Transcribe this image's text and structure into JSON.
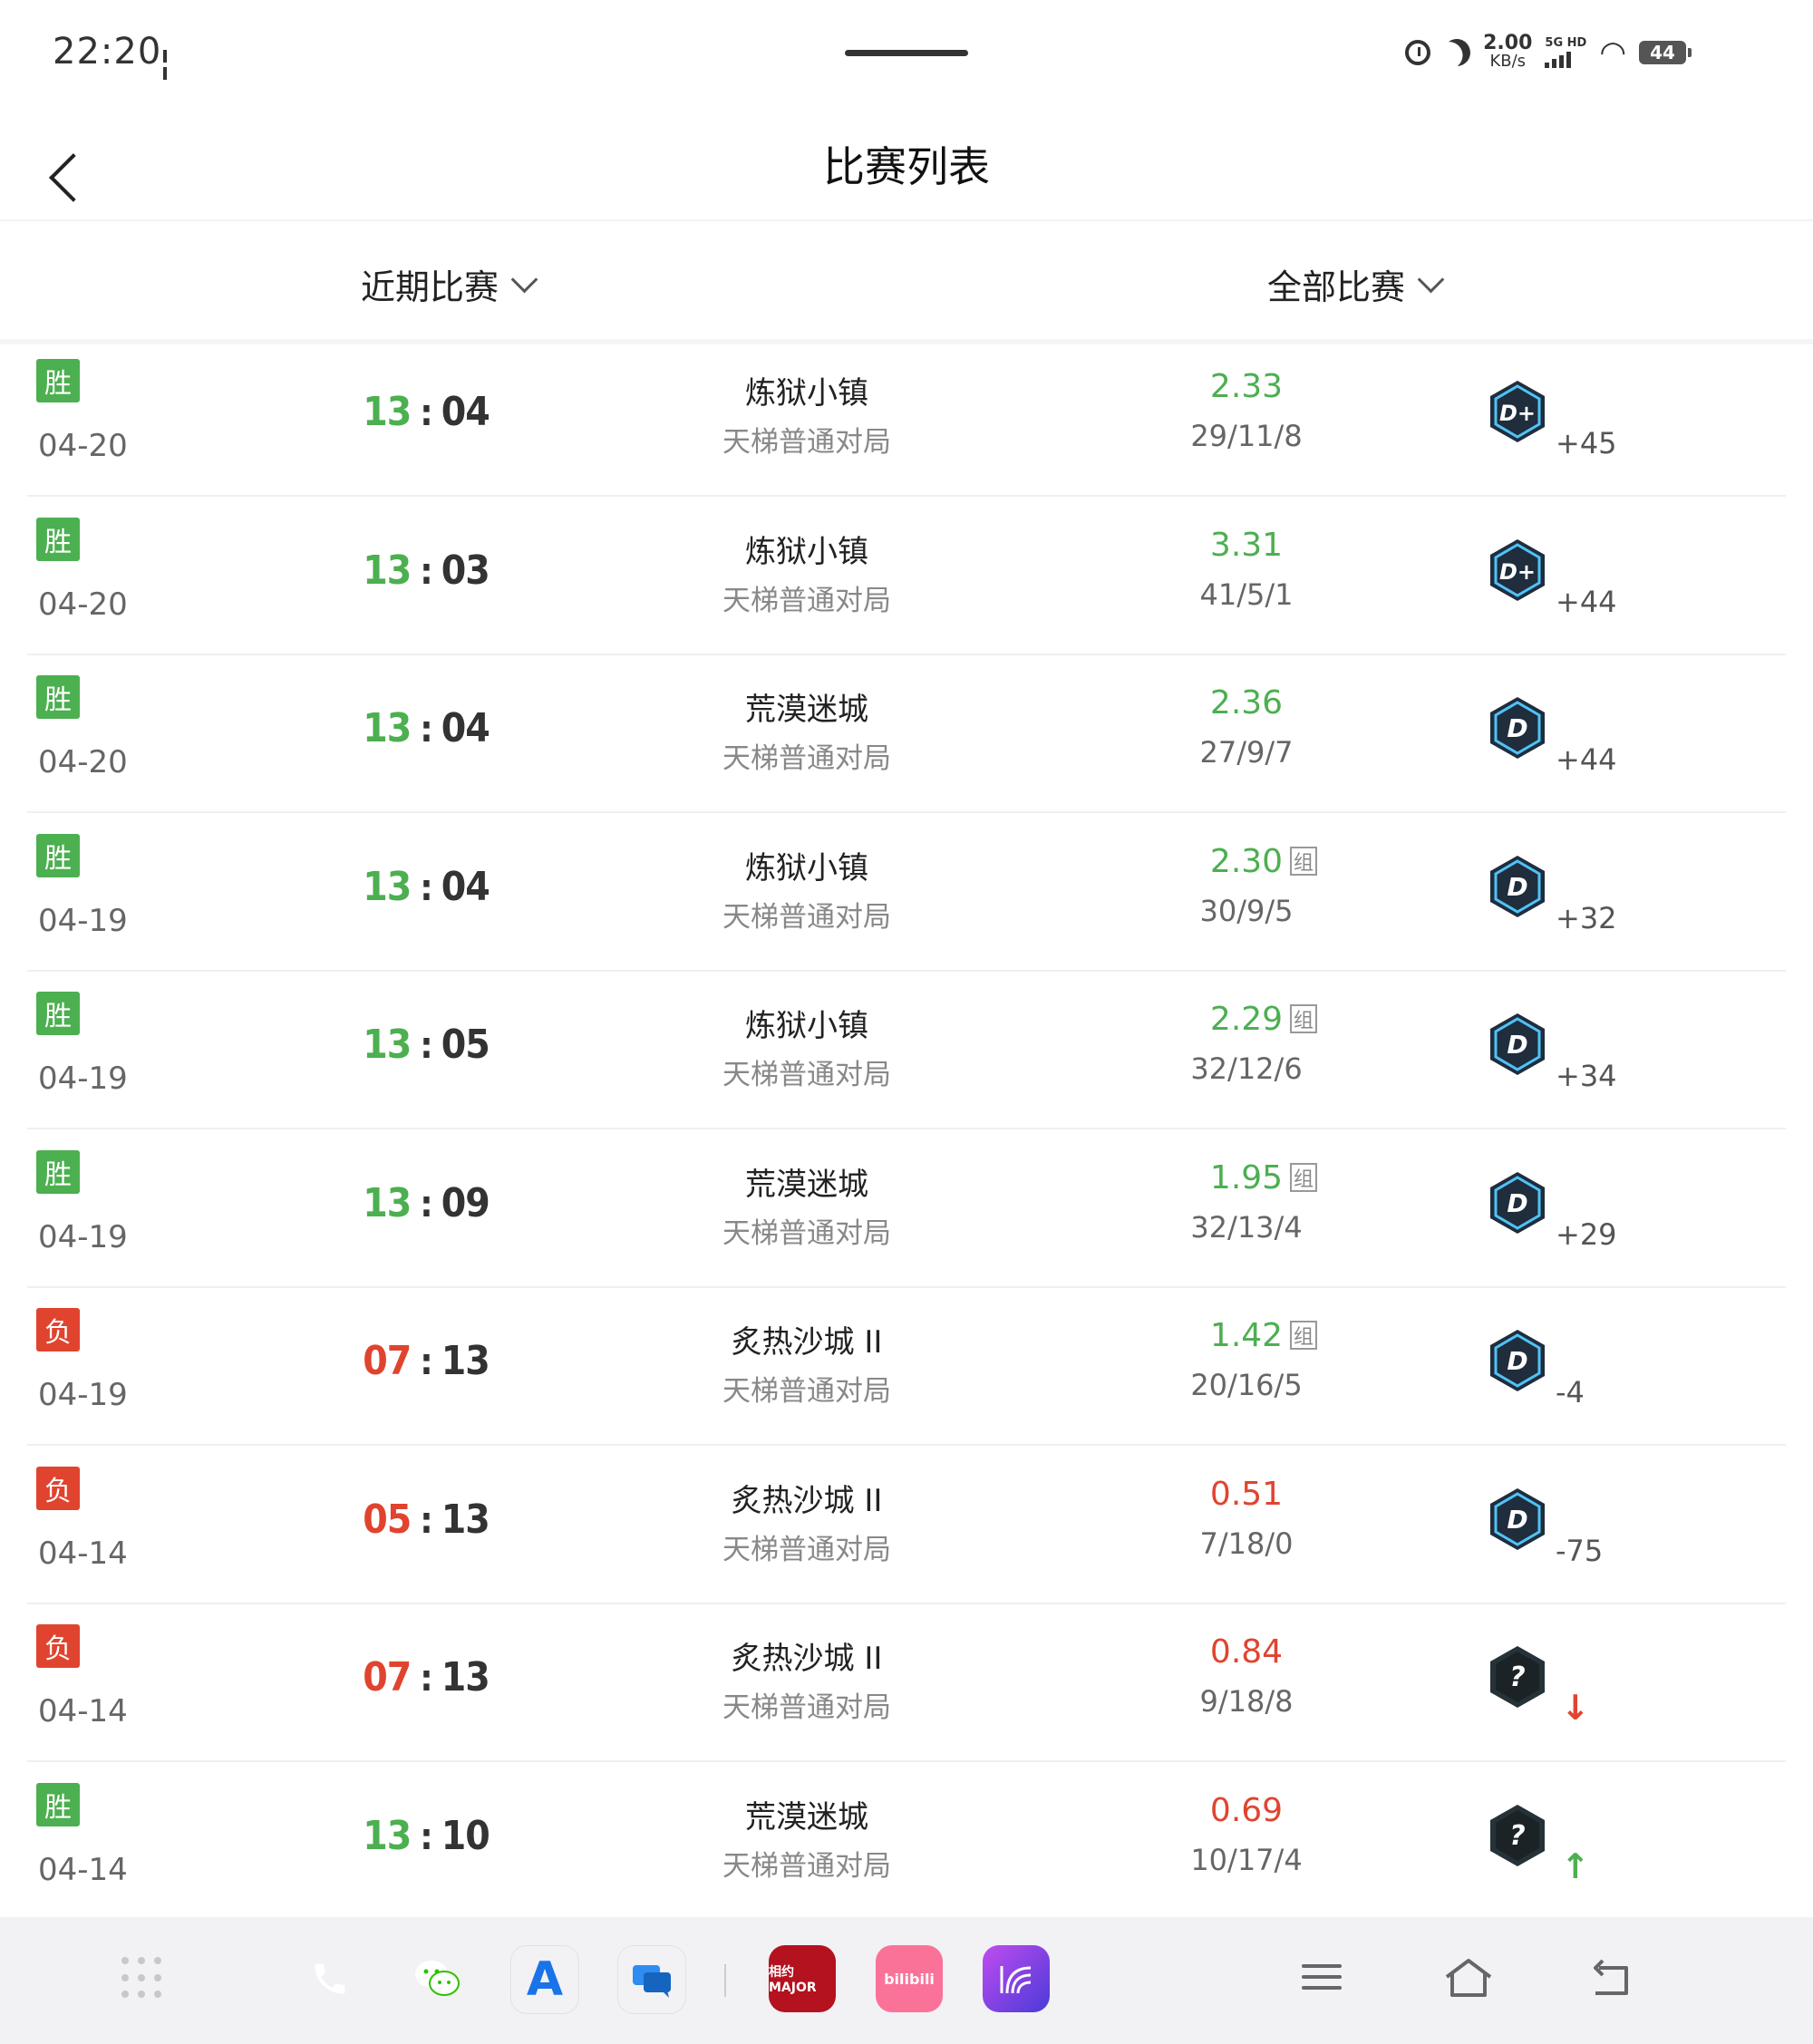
{
  "status_bar": {
    "time": "22:20",
    "net_speed_value": "2.00",
    "net_speed_unit": "KB/s",
    "signal_label": "5G HD",
    "battery": "44"
  },
  "header": {
    "title": "比赛列表"
  },
  "filters": [
    {
      "label": "近期比赛"
    },
    {
      "label": "全部比赛"
    }
  ],
  "matches": [
    {
      "result": "胜",
      "result_type": "win",
      "date": "04-20",
      "score_a": "13",
      "score_b": "04",
      "map": "炼狱小镇",
      "mode": "天梯普通对局",
      "rating": "2.33",
      "rating_type": "good",
      "group": "",
      "kda": "29/11/8",
      "rank_icon": "rank-dplus-icon",
      "rank_letter": "D+",
      "elo": "+45",
      "arrow": ""
    },
    {
      "result": "胜",
      "result_type": "win",
      "date": "04-20",
      "score_a": "13",
      "score_b": "03",
      "map": "炼狱小镇",
      "mode": "天梯普通对局",
      "rating": "3.31",
      "rating_type": "good",
      "group": "",
      "kda": "41/5/1",
      "rank_icon": "rank-dplus-icon",
      "rank_letter": "D+",
      "elo": "+44",
      "arrow": ""
    },
    {
      "result": "胜",
      "result_type": "win",
      "date": "04-20",
      "score_a": "13",
      "score_b": "04",
      "map": "荒漠迷城",
      "mode": "天梯普通对局",
      "rating": "2.36",
      "rating_type": "good",
      "group": "",
      "kda": "27/9/7",
      "rank_icon": "rank-d-icon",
      "rank_letter": "D",
      "elo": "+44",
      "arrow": ""
    },
    {
      "result": "胜",
      "result_type": "win",
      "date": "04-19",
      "score_a": "13",
      "score_b": "04",
      "map": "炼狱小镇",
      "mode": "天梯普通对局",
      "rating": "2.30",
      "rating_type": "good",
      "group": "组",
      "kda": "30/9/5",
      "rank_icon": "rank-d-icon",
      "rank_letter": "D",
      "elo": "+32",
      "arrow": ""
    },
    {
      "result": "胜",
      "result_type": "win",
      "date": "04-19",
      "score_a": "13",
      "score_b": "05",
      "map": "炼狱小镇",
      "mode": "天梯普通对局",
      "rating": "2.29",
      "rating_type": "good",
      "group": "组",
      "kda": "32/12/6",
      "rank_icon": "rank-d-icon",
      "rank_letter": "D",
      "elo": "+34",
      "arrow": ""
    },
    {
      "result": "胜",
      "result_type": "win",
      "date": "04-19",
      "score_a": "13",
      "score_b": "09",
      "map": "荒漠迷城",
      "mode": "天梯普通对局",
      "rating": "1.95",
      "rating_type": "good",
      "group": "组",
      "kda": "32/13/4",
      "rank_icon": "rank-d-icon",
      "rank_letter": "D",
      "elo": "+29",
      "arrow": ""
    },
    {
      "result": "负",
      "result_type": "loss",
      "date": "04-19",
      "score_a": "07",
      "score_b": "13",
      "map": "炙热沙城 II",
      "mode": "天梯普通对局",
      "rating": "1.42",
      "rating_type": "good",
      "group": "组",
      "kda": "20/16/5",
      "rank_icon": "rank-d-icon",
      "rank_letter": "D",
      "elo": "-4",
      "arrow": ""
    },
    {
      "result": "负",
      "result_type": "loss",
      "date": "04-14",
      "score_a": "05",
      "score_b": "13",
      "map": "炙热沙城 II",
      "mode": "天梯普通对局",
      "rating": "0.51",
      "rating_type": "bad",
      "group": "",
      "kda": "7/18/0",
      "rank_icon": "rank-d-icon",
      "rank_letter": "D",
      "elo": "-75",
      "arrow": ""
    },
    {
      "result": "负",
      "result_type": "loss",
      "date": "04-14",
      "score_a": "07",
      "score_b": "13",
      "map": "炙热沙城 II",
      "mode": "天梯普通对局",
      "rating": "0.84",
      "rating_type": "bad",
      "group": "",
      "kda": "9/18/8",
      "rank_icon": "rank-unknown-icon",
      "rank_letter": "?",
      "elo": "",
      "arrow": "down"
    },
    {
      "result": "胜",
      "result_type": "win",
      "date": "04-14",
      "score_a": "13",
      "score_b": "10",
      "map": "荒漠迷城",
      "mode": "天梯普通对局",
      "rating": "0.69",
      "rating_type": "bad",
      "group": "",
      "kda": "10/17/4",
      "rank_icon": "rank-unknown-icon",
      "rank_letter": "?",
      "elo": "",
      "arrow": "up"
    }
  ],
  "dock": {
    "apps": [
      {
        "name": "phone-app-icon",
        "color": "#2ecc71"
      },
      {
        "name": "wechat-app-icon",
        "color": "#2dc100"
      },
      {
        "name": "app-store-icon",
        "color": "#ffffff"
      },
      {
        "name": "messages-app-icon",
        "color": "#ffffff"
      },
      {
        "name": "major-app-icon",
        "color": "#b3121e",
        "label": "相约MAJOR"
      },
      {
        "name": "bilibili-app-icon",
        "color": "#fb7299",
        "label": "bilibili"
      },
      {
        "name": "purple-app-icon",
        "color": "#7b3fe4"
      }
    ]
  },
  "colors": {
    "win": "#4caf50",
    "loss": "#e0442f"
  }
}
